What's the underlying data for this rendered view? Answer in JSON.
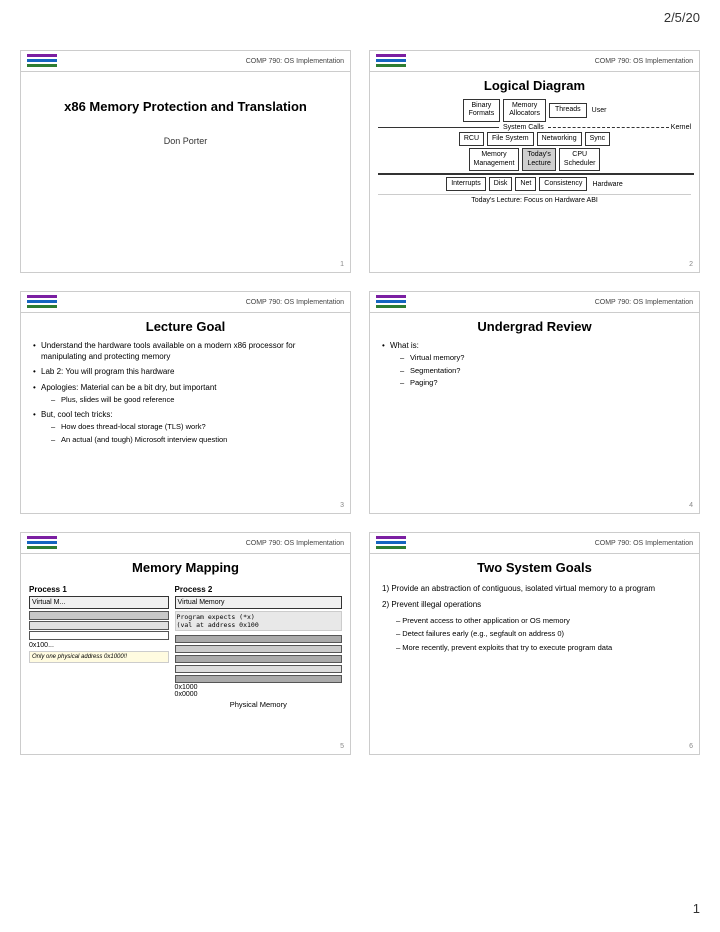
{
  "page": {
    "date": "2/5/20",
    "page_number": "1"
  },
  "slides": [
    {
      "id": 1,
      "course": "COMP 790: OS Implementation",
      "title": "x86 Memory Protection and Translation",
      "author": "Don Porter",
      "slide_number": "1"
    },
    {
      "id": 2,
      "course": "COMP 790: OS Implementation",
      "title": "Logical Diagram",
      "rows": [
        [
          "Binary Formats",
          "Memory Allocators",
          "Threads"
        ],
        [
          "System Calls"
        ],
        [
          "RCU",
          "File System",
          "Networking",
          "Sync"
        ],
        [
          "Memory Management",
          "Today's Lecture",
          "CPU Scheduler"
        ],
        [
          "Interrupts",
          "Disk",
          "Net",
          "Consistency"
        ]
      ],
      "labels": [
        "User",
        "Kernel",
        "Hardware"
      ],
      "today_note": "Today's Lecture: Focus on Hardware ABI",
      "slide_number": "2"
    },
    {
      "id": 3,
      "course": "COMP 790: OS Implementation",
      "title": "Lecture Goal",
      "bullets": [
        {
          "text": "Understand the hardware tools available on a modern x86 processor for manipulating and protecting memory",
          "sub": []
        },
        {
          "text": "Lab 2: You will program this hardware",
          "sub": []
        },
        {
          "text": "Apologies: Material can be a bit dry, but important",
          "sub": [
            "Plus, slides will be good reference"
          ]
        },
        {
          "text": "But, cool tech tricks:",
          "sub": [
            "How does thread-local storage (TLS) work?",
            "An actual (and tough) Microsoft interview question"
          ]
        }
      ],
      "slide_number": "3"
    },
    {
      "id": 4,
      "course": "COMP 790: OS Implementation",
      "title": "Undergrad Review",
      "bullets": [
        {
          "text": "What is:",
          "sub": [
            "Virtual memory?",
            "Segmentation?",
            "Paging?"
          ]
        }
      ],
      "slide_number": "4"
    },
    {
      "id": 5,
      "course": "COMP 790: OS Implementation",
      "title": "Memory Mapping",
      "process1": "Process 1",
      "process2": "Process 2",
      "vm_label1": "Virtual M...",
      "vm_label2": "Virtual Memory",
      "note1": "Only one physical address 0x1000!!",
      "code1": "Program expects (*x)",
      "code2": "(val at",
      "code3": "address 0x100",
      "addr1": "0x100...",
      "addr2": "0x1000",
      "addr3": "0x0000",
      "phys_label": "Physical Memory",
      "slide_number": "5"
    },
    {
      "id": 6,
      "course": "COMP 790: OS Implementation",
      "title": "Two System Goals",
      "goal1": "1) Provide an abstraction of contiguous, isolated virtual memory to a program",
      "goal2": "2) Prevent illegal operations",
      "sub_goals": [
        "– Prevent access to other application or OS memory",
        "– Detect failures early (e.g., segfault on address 0)",
        "– More recently, prevent exploits that try to execute program data"
      ],
      "slide_number": "6"
    }
  ]
}
